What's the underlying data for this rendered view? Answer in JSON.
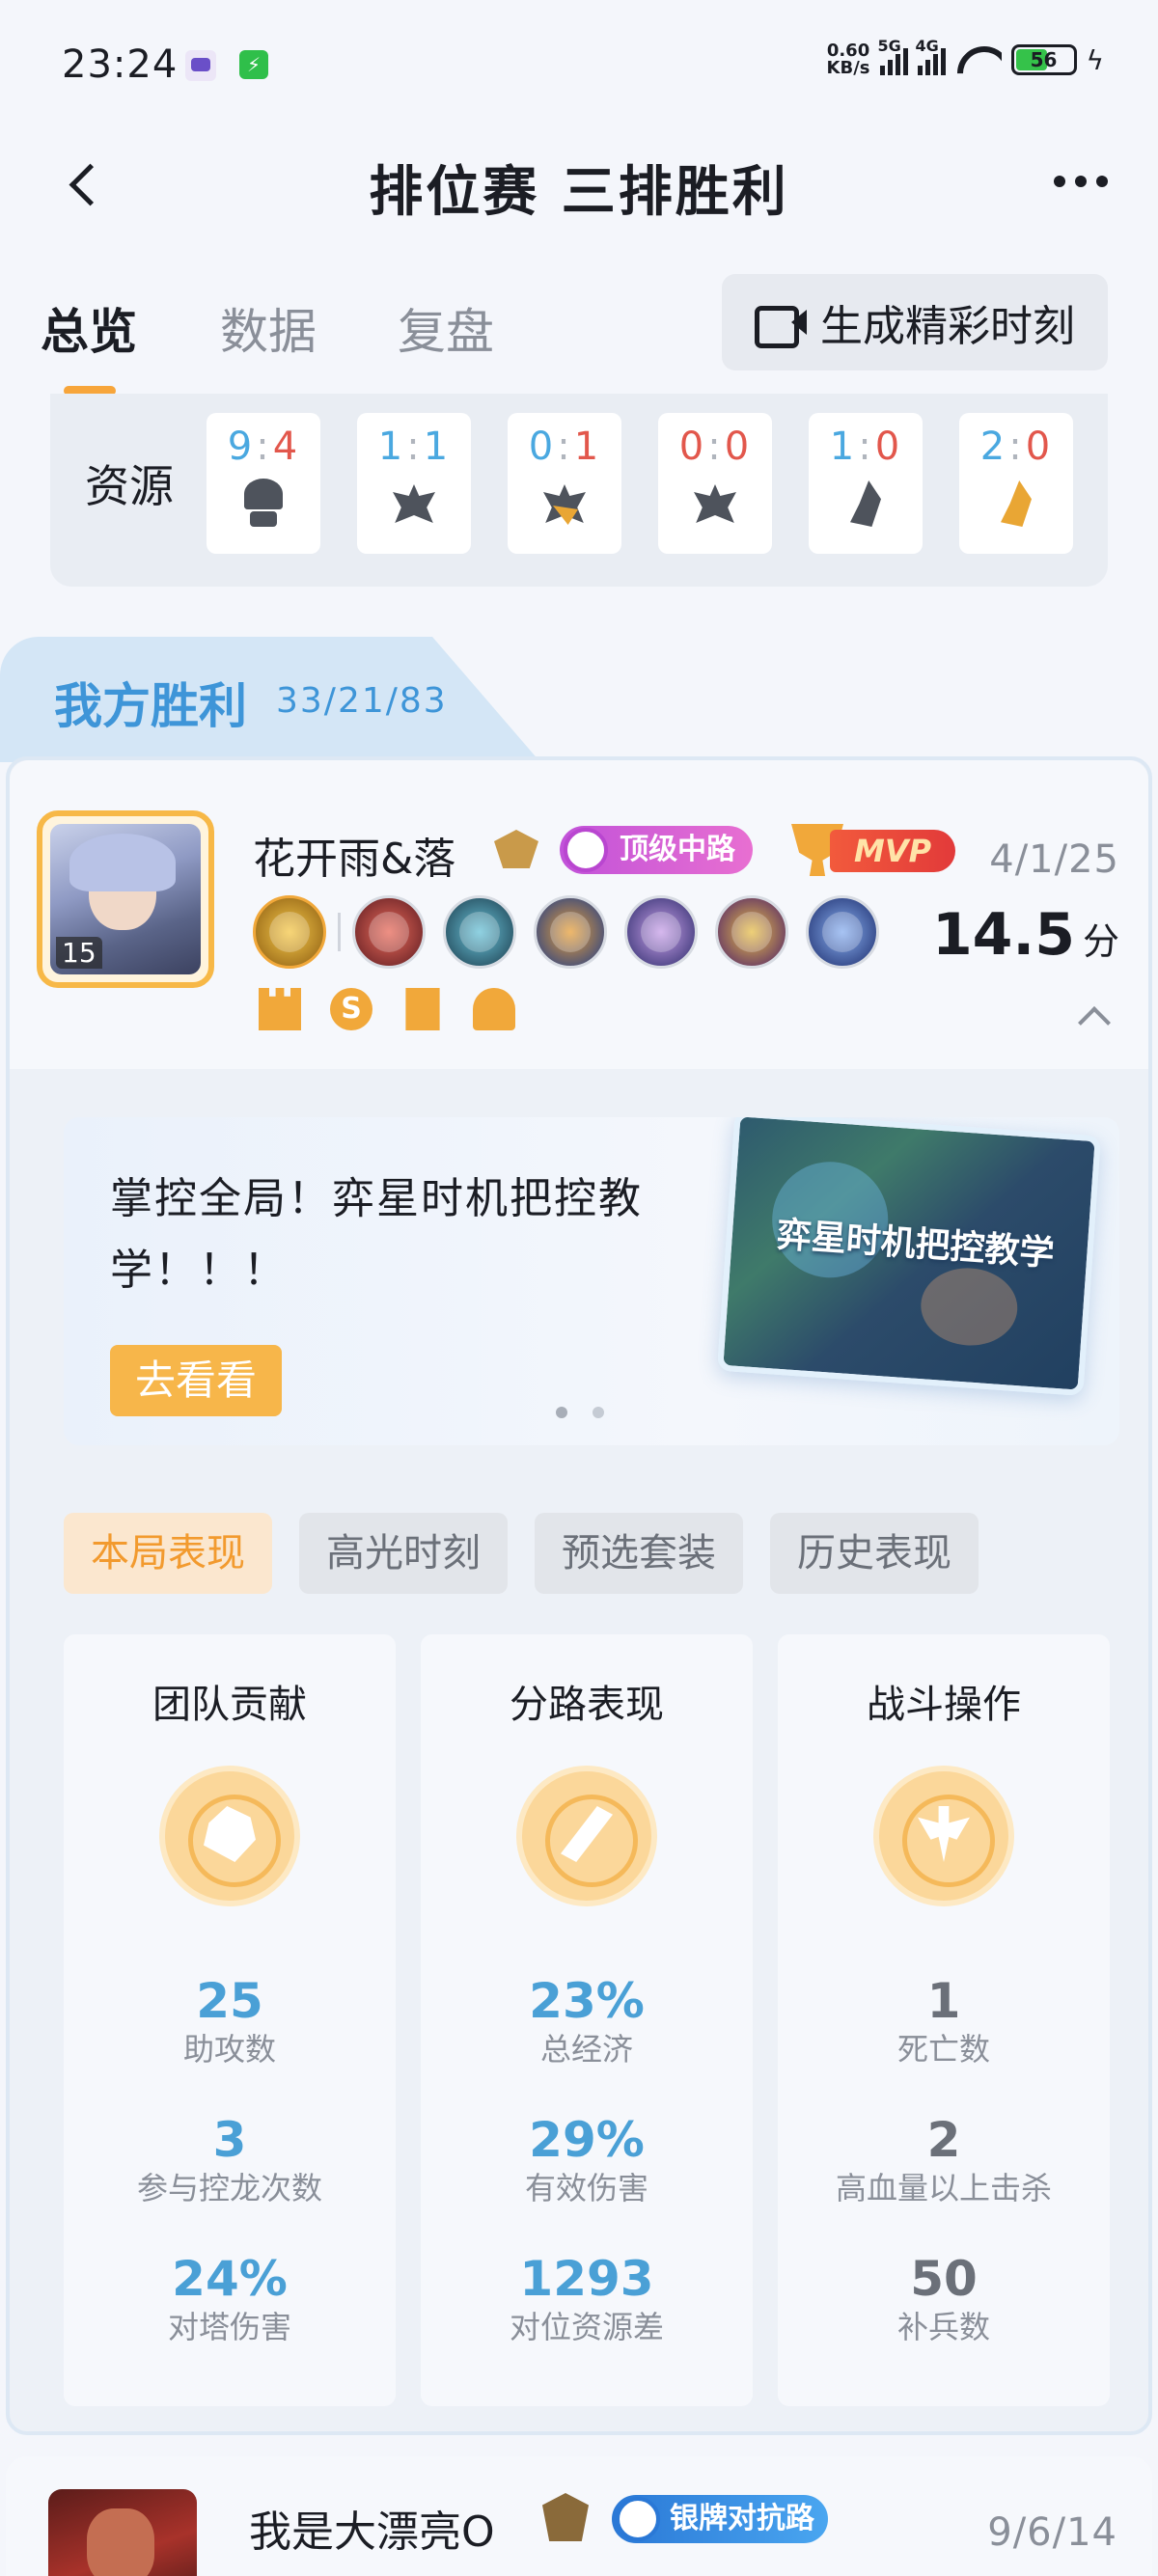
{
  "status_bar": {
    "time": "23:24",
    "net_speed_value": "0.60",
    "net_speed_unit": "KB/s",
    "sim1_label": "5G",
    "sim2_label": "4G",
    "battery": "56"
  },
  "header": {
    "title": "排位赛 三排胜利"
  },
  "tabs": {
    "overview": "总览",
    "data": "数据",
    "replay": "复盘",
    "highlight_button": "生成精彩时刻"
  },
  "resources": {
    "label": "资源",
    "items": [
      {
        "left": "9",
        "right": "4",
        "icon": "tower-icon"
      },
      {
        "left": "1",
        "right": "1",
        "icon": "dragon-icon"
      },
      {
        "left": "0",
        "right": "1",
        "icon": "golden-dragon-icon"
      },
      {
        "left": "0",
        "right": "0",
        "icon": "dark-dragon-icon"
      },
      {
        "left": "1",
        "right": "0",
        "icon": "flame-icon"
      },
      {
        "left": "2",
        "right": "0",
        "icon": "golden-flame-icon"
      }
    ]
  },
  "team": {
    "label": "我方胜利",
    "kda": "33/21/83"
  },
  "player": {
    "name": "花开雨&落",
    "level": "15",
    "role_tag": "顶级中路",
    "mvp": "MVP",
    "kda": "4/1/25",
    "score": "14.5",
    "score_unit": "分"
  },
  "promo": {
    "title": "掌控全局！弈星时机把控教学！！！",
    "button": "去看看",
    "image_caption": "弈星时机把控教学"
  },
  "perf_tabs": [
    "本局表现",
    "高光时刻",
    "预选套装",
    "历史表现"
  ],
  "stats": [
    {
      "title": "团队贡献",
      "icon": "handshake-icon",
      "items": [
        {
          "value": "25",
          "label": "助攻数"
        },
        {
          "value": "3",
          "label": "参与控龙次数"
        },
        {
          "value": "24%",
          "label": "对塔伤害"
        }
      ]
    },
    {
      "title": "分路表现",
      "icon": "lane-icon",
      "items": [
        {
          "value": "23%",
          "label": "总经济"
        },
        {
          "value": "29%",
          "label": "有效伤害"
        },
        {
          "value": "1293",
          "label": "对位资源差"
        }
      ]
    },
    {
      "title": "战斗操作",
      "icon": "sword-icon",
      "items": [
        {
          "value": "1",
          "label": "死亡数"
        },
        {
          "value": "2",
          "label": "高血量以上击杀"
        },
        {
          "value": "50",
          "label": "补兵数"
        }
      ]
    }
  ],
  "player2": {
    "name": "我是大漂亮O",
    "role_tag": "银牌对抗路",
    "kda": "9/6/14"
  },
  "colors": {
    "accent_orange": "#f7a53a",
    "blue": "#4aa0d6",
    "red": "#e2574c"
  }
}
